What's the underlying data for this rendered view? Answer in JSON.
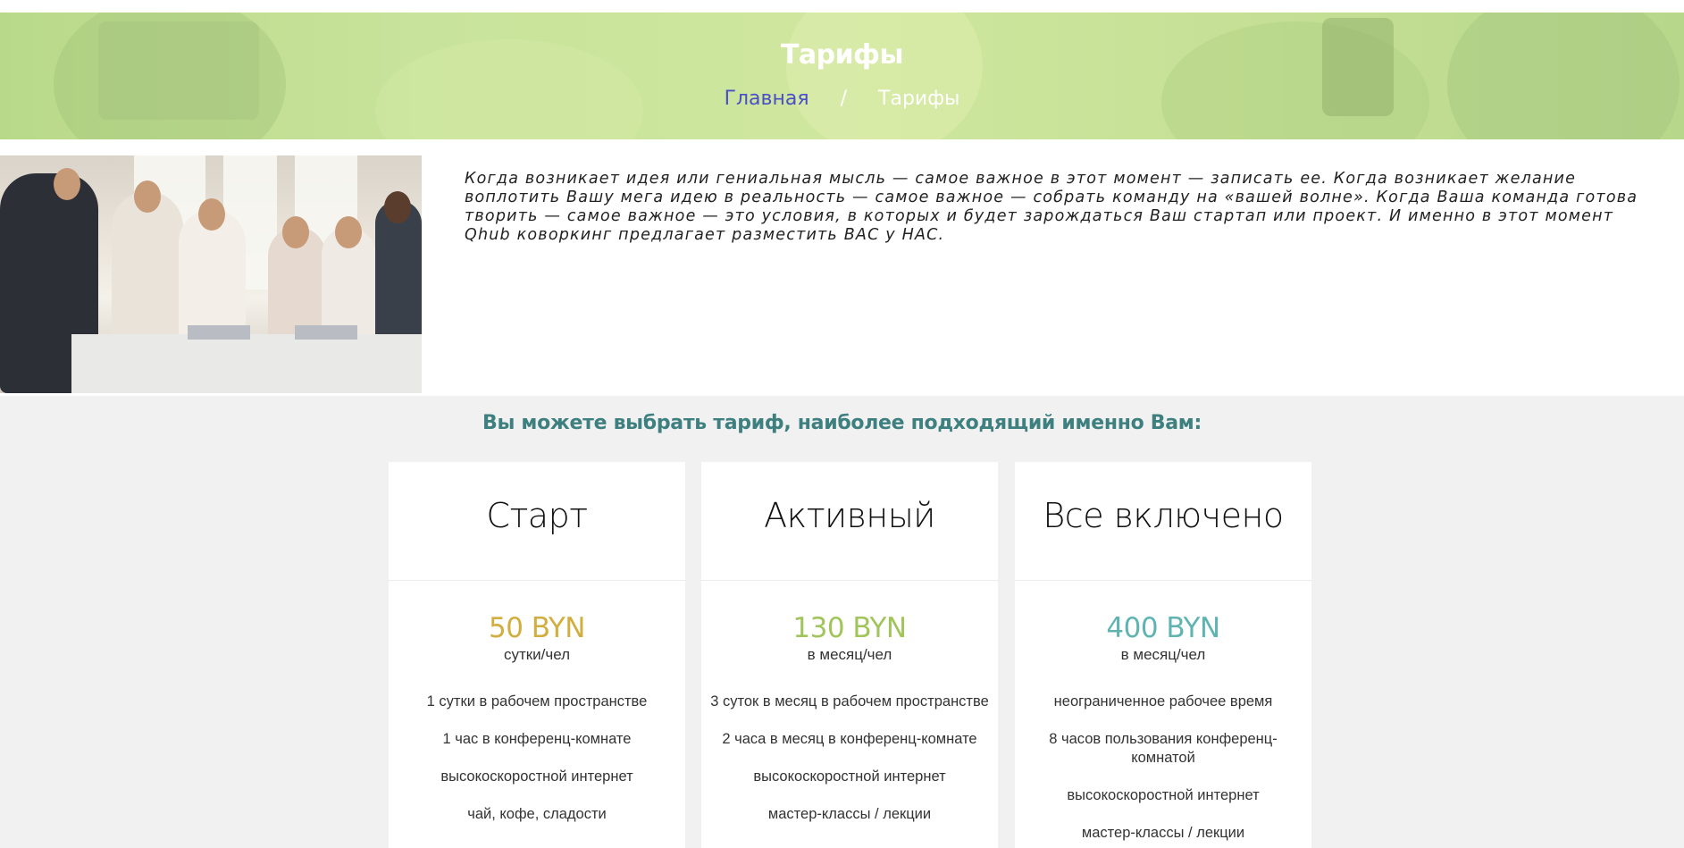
{
  "header": {
    "title": "Тарифы",
    "breadcrumb": {
      "home": "Главная",
      "separator": "/",
      "current": "Тарифы"
    }
  },
  "intro": {
    "text": "Когда возникает идея или гениальная мысль — самое важное в этот момент — записать ее. Когда возникает желание воплотить Вашу мега идею в реальность — самое важное — собрать команду на «вашей волне». Когда Ваша команда готова творить — самое важное — это условия, в которых и будет зарождаться Ваш стартап или проект. И именно в этот момент Qhub коворкинг предлагает разместить ВАС у НАС."
  },
  "pricing": {
    "heading": "Вы можете выбрать тариф, наиболее подходящий именно Вам:",
    "plans": [
      {
        "name": "Старт",
        "price": "50 BYN",
        "unit": "сутки/чел",
        "accent": "#d1ae3f",
        "features": [
          "1 сутки в рабочем пространстве",
          "1 час в конференц-комнате",
          "высокоскоростной интернет",
          "чай, кофе, сладости"
        ]
      },
      {
        "name": "Активный",
        "price": "130 BYN",
        "unit": "в месяц/чел",
        "accent": "#a1c55b",
        "features": [
          "3 суток в месяц в рабочем пространстве",
          "2 часа в месяц в конференц-комнате",
          "высокоскоростной интернет",
          "мастер-классы / лекции"
        ]
      },
      {
        "name": "Все включено",
        "price": "400 BYN",
        "unit": "в месяц/чел",
        "accent": "#5fb4b2",
        "features": [
          "неограниченное рабочее время",
          "8 часов пользования конференц-комнатой",
          "высокоскоростной интернет",
          "мастер-классы / лекции"
        ]
      }
    ]
  },
  "colors": {
    "hero_green": "#c8e39b",
    "heading_teal": "#3e7f7f",
    "link_blue": "#4a4fc7",
    "page_bg": "#f1f1f1"
  }
}
